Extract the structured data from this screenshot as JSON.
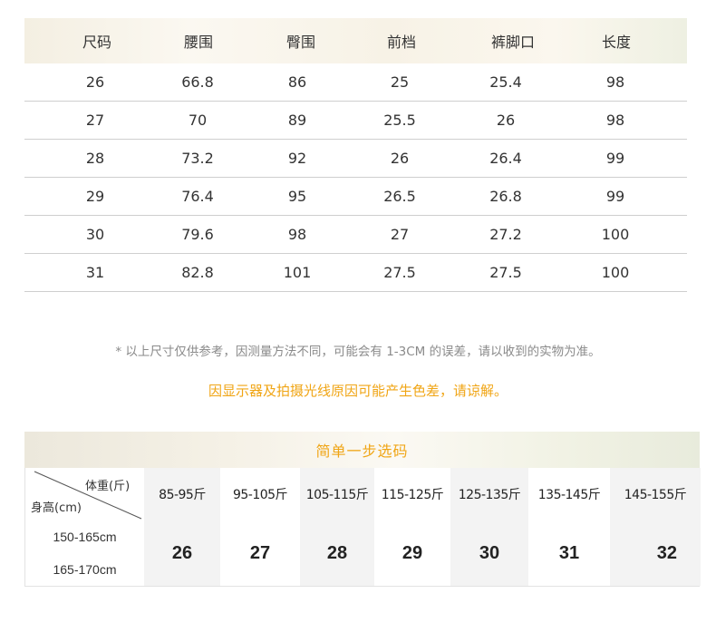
{
  "size_table": {
    "headers": [
      "尺码",
      "腰围",
      "臀围",
      "前档",
      "裤脚口",
      "长度"
    ],
    "rows": [
      [
        "26",
        "66.8",
        "86",
        "25",
        "25.4",
        "98"
      ],
      [
        "27",
        "70",
        "89",
        "25.5",
        "26",
        "98"
      ],
      [
        "28",
        "73.2",
        "92",
        "26",
        "26.4",
        "99"
      ],
      [
        "29",
        "76.4",
        "95",
        "26.5",
        "26.8",
        "99"
      ],
      [
        "30",
        "79.6",
        "98",
        "27",
        "27.2",
        "100"
      ],
      [
        "31",
        "82.8",
        "101",
        "27.5",
        "27.5",
        "100"
      ]
    ]
  },
  "notes": {
    "disclaimer": "* 以上尺寸仅供参考，因测量方法不同，可能会有 1-3CM 的误差，请以收到的实物为准。",
    "color_notice": "因显示器及拍摄光线原因可能产生色差，请谅解。"
  },
  "quick_pick": {
    "title": "简单一步选码",
    "weight_label": "体重(斤)",
    "height_label": "身高(cm)",
    "weight_ranges": [
      "85-95斤",
      "95-105斤",
      "105-115斤",
      "115-125斤",
      "125-135斤",
      "135-145斤",
      "145-155斤"
    ],
    "height_ranges": [
      "150-165cm",
      "165-170cm"
    ],
    "sizes": [
      "26",
      "27",
      "28",
      "29",
      "30",
      "31",
      "32"
    ]
  },
  "colors": {
    "accent": "#f0a515",
    "text": "#4a4a4a",
    "muted": "#8a8a8a",
    "divider": "#cfcfcf",
    "shade": "#f3f3f3"
  }
}
